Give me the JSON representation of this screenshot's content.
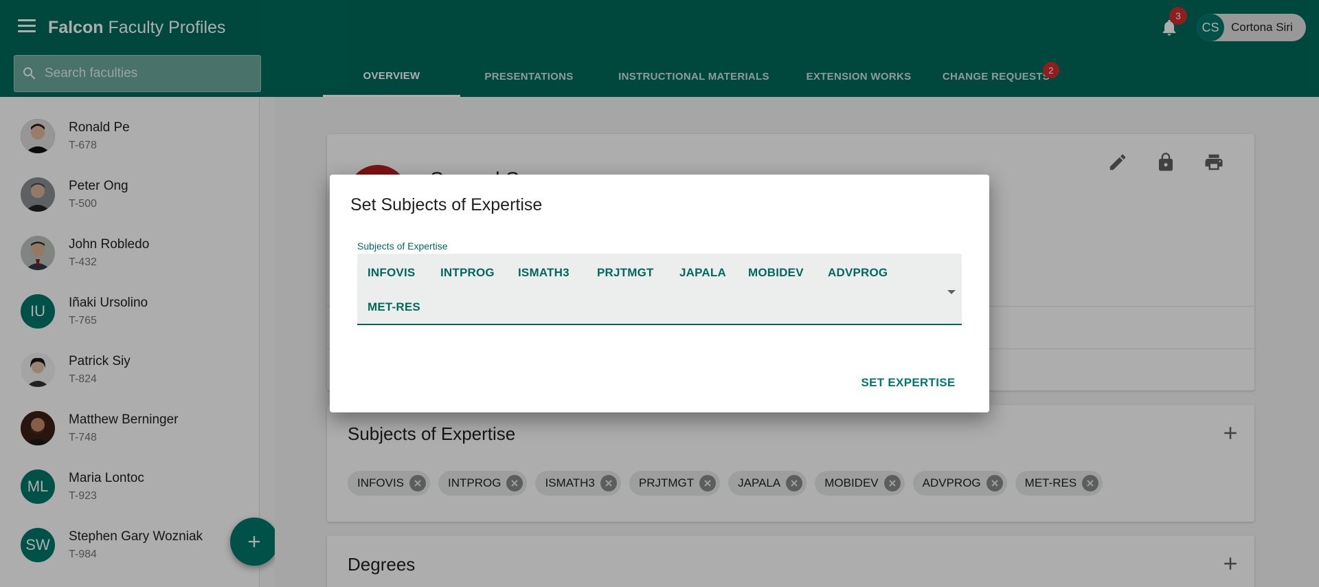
{
  "app": {
    "title_bold": "Falcon",
    "title_rest": "Faculty Profiles",
    "notification_count": "3",
    "user_initials": "CS",
    "user_name": "Cortona Siri"
  },
  "search": {
    "placeholder": "Search faculties"
  },
  "tabs": [
    {
      "label": "OVERVIEW",
      "active": true
    },
    {
      "label": "PRESENTATIONS"
    },
    {
      "label": "INSTRUCTIONAL MATERIALS"
    },
    {
      "label": "EXTENSION WORKS"
    },
    {
      "label": "CHANGE REQUESTS",
      "badge": "2"
    }
  ],
  "faculties": [
    {
      "name": "Ronald Pe",
      "id": "T-678",
      "initials": ""
    },
    {
      "name": "Peter Ong",
      "id": "T-500",
      "initials": ""
    },
    {
      "name": "John Robledo",
      "id": "T-432",
      "initials": ""
    },
    {
      "name": "Iñaki Ursolino",
      "id": "T-765",
      "initials": "IU"
    },
    {
      "name": "Patrick Siy",
      "id": "T-824",
      "initials": ""
    },
    {
      "name": "Matthew Berninger",
      "id": "T-748",
      "initials": ""
    },
    {
      "name": "Maria Lontoc",
      "id": "T-923",
      "initials": "ML"
    },
    {
      "name": "Stephen Gary Wozniak",
      "id": "T-984",
      "initials": "SW"
    }
  ],
  "profile": {
    "name_partial": "Samuel S"
  },
  "expertise_card": {
    "title": "Subjects of Expertise",
    "chips": [
      "INFOVIS",
      "INTPROG",
      "ISMATH3",
      "PRJTMGT",
      "JAPALA",
      "MOBIDEV",
      "ADVPROG",
      "MET-RES"
    ]
  },
  "degrees_card": {
    "title": "Degrees"
  },
  "dialog": {
    "title": "Set Subjects of Expertise",
    "field_label": "Subjects of Expertise",
    "selected": [
      "INFOVIS",
      "INTPROG",
      "ISMATH3",
      "PRJTMGT",
      "JAPALA",
      "MOBIDEV",
      "ADVPROG",
      "MET-RES"
    ],
    "submit_label": "SET EXPERTISE"
  },
  "colors": {
    "primary": "#006b5c",
    "accent": "#00796b",
    "badge": "#d32f2f"
  }
}
